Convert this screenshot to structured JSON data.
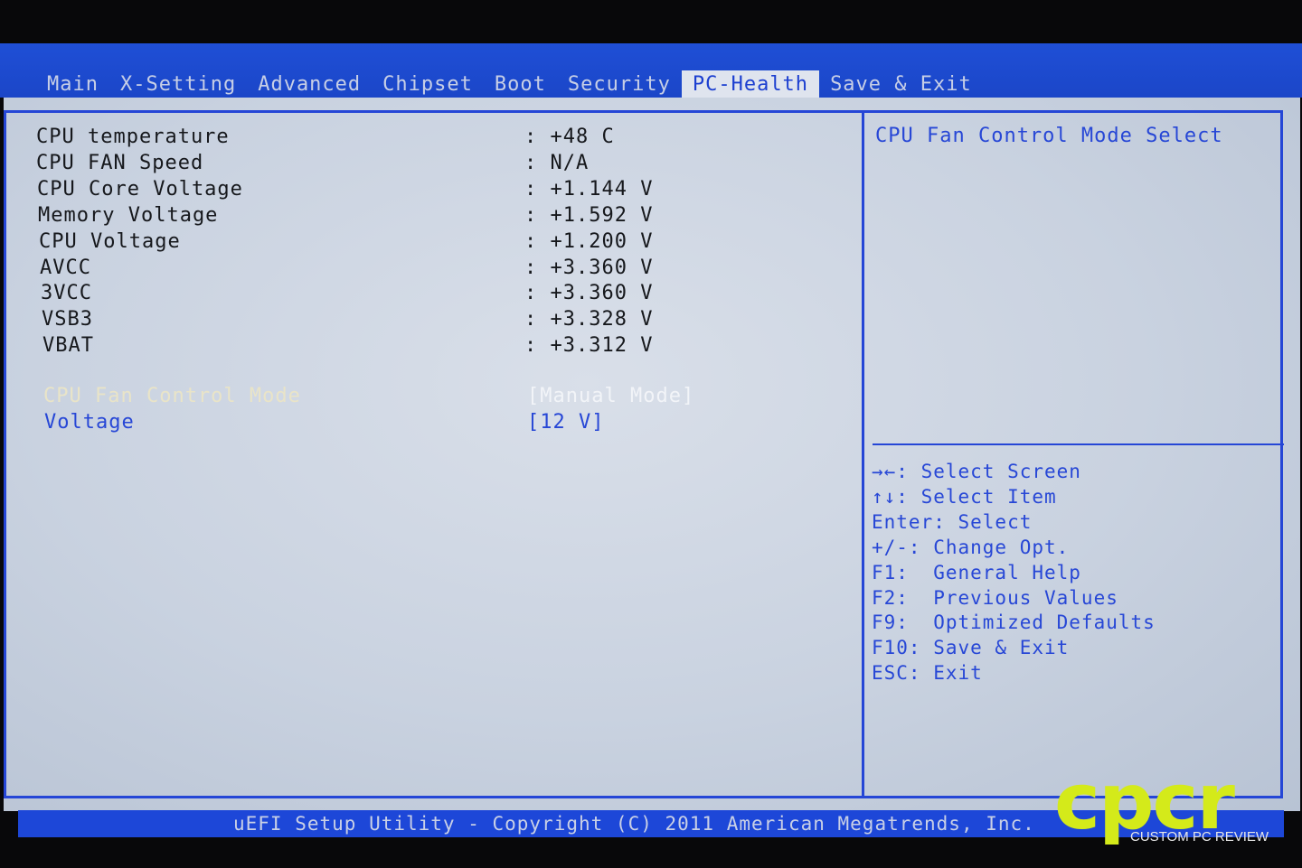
{
  "tabs": [
    {
      "label": "Main",
      "active": false
    },
    {
      "label": "X-Setting",
      "active": false
    },
    {
      "label": "Advanced",
      "active": false
    },
    {
      "label": "Chipset",
      "active": false
    },
    {
      "label": "Boot",
      "active": false
    },
    {
      "label": "Security",
      "active": false
    },
    {
      "label": "PC-Health",
      "active": true
    },
    {
      "label": "Save & Exit",
      "active": false
    }
  ],
  "readings": [
    {
      "label": "CPU temperature",
      "value": ": +48 C"
    },
    {
      "label": "CPU FAN Speed",
      "value": ": N/A"
    },
    {
      "label": "CPU Core Voltage",
      "value": ": +1.144 V"
    },
    {
      "label": "Memory Voltage",
      "value": ": +1.592 V"
    },
    {
      "label": "CPU Voltage",
      "value": ": +1.200 V"
    },
    {
      "label": "AVCC",
      "value": ": +3.360 V"
    },
    {
      "label": "3VCC",
      "value": ": +3.360 V"
    },
    {
      "label": "VSB3",
      "value": ": +3.328 V"
    },
    {
      "label": "VBAT",
      "value": ": +3.312 V"
    }
  ],
  "settings": [
    {
      "label": "CPU Fan Control Mode",
      "value": "[Manual Mode]"
    },
    {
      "label": "Voltage",
      "value": "[12 V]"
    }
  ],
  "help": {
    "title": "CPU Fan Control Mode Select"
  },
  "keys": [
    "→←: Select Screen",
    "↑↓: Select Item",
    "Enter: Select",
    "+/-: Change Opt.",
    "F1:  General Help",
    "F2:  Previous Values",
    "F9:  Optimized Defaults",
    "F10: Save & Exit",
    "ESC: Exit"
  ],
  "footer": {
    "copyright": "uEFI Setup Utility - Copyright (C) 2011 American Megatrends, Inc."
  },
  "watermark": {
    "logo": "cpcr",
    "tagline": "CUSTOM PC REVIEW"
  },
  "colors": {
    "accent_blue": "#2747d6",
    "panel_bg": "#d0d8e4",
    "highlight": "#e9e4c8",
    "logo_green": "#d4ea1a"
  }
}
